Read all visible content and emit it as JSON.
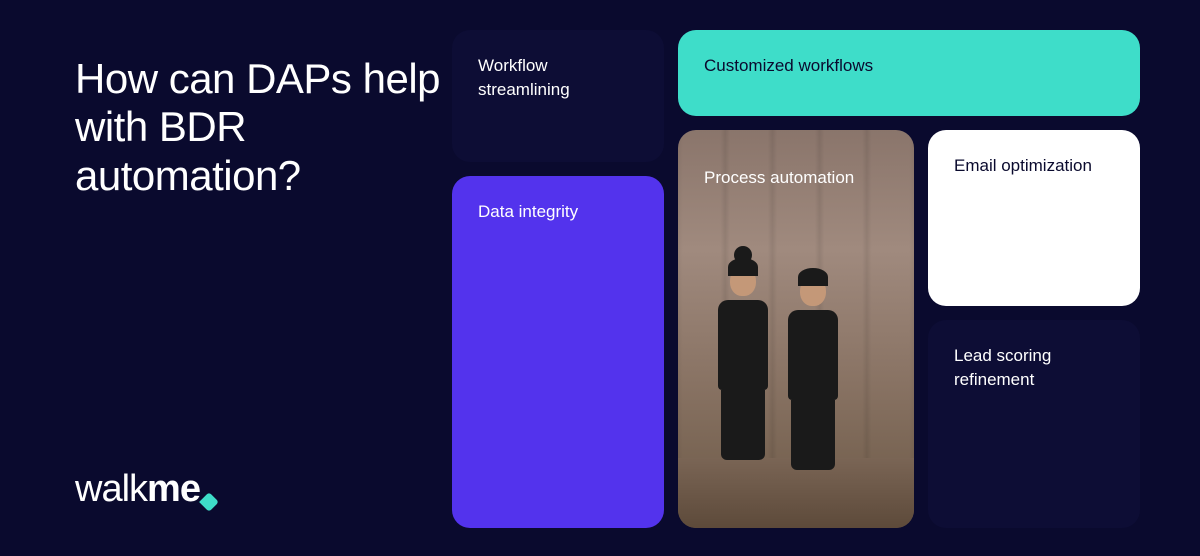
{
  "heading": "How can DAPs help with BDR automation?",
  "logo": {
    "text_light": "walk",
    "text_bold": "me"
  },
  "cards": {
    "workflow": "Workflow streamlining",
    "customized": "Customized workflows",
    "data": "Data integrity",
    "process": "Process automation",
    "email": "Email optimization",
    "lead": "Lead scoring refinement"
  }
}
